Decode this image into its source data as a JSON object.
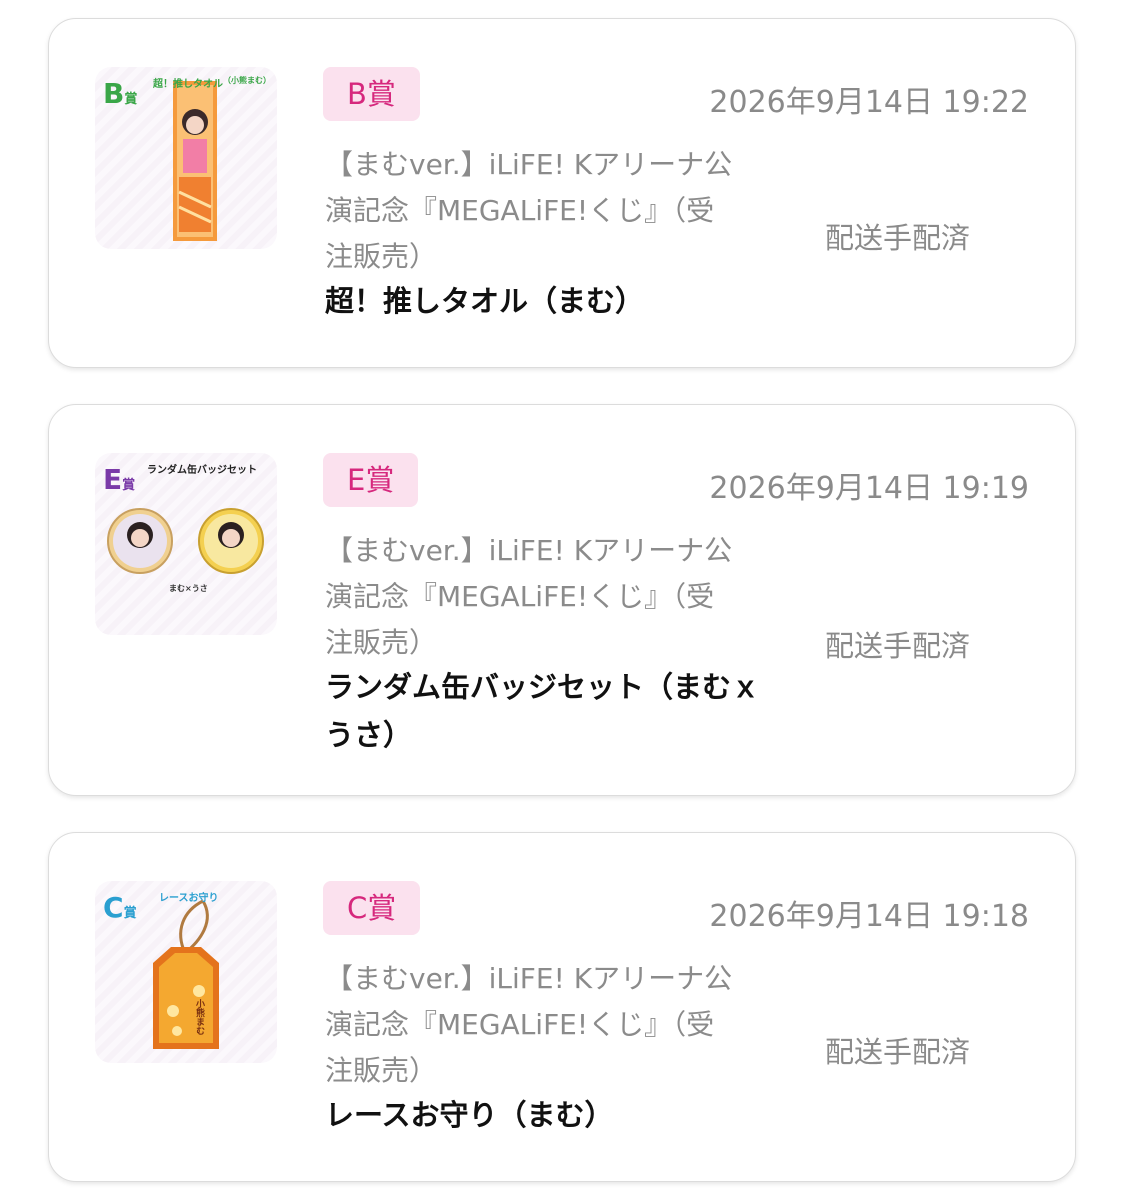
{
  "orders": [
    {
      "prize_badge": "B賞",
      "date": "2026年9月14日 19:22",
      "title": "【まむver.】iLiFE! Kアリーナ公演記念『MEGALiFE!くじ』（受注販売）",
      "item_name": "超！推しタオル（まむ）",
      "status": "配送手配済",
      "thumbnail": {
        "letter": "B",
        "letter_suffix": "賞",
        "label": "超！推しタオル",
        "sublabel": "（小熊まむ）",
        "letter_color": "#3aa648"
      }
    },
    {
      "prize_badge": "E賞",
      "date": "2026年9月14日 19:19",
      "title": "【まむver.】iLiFE! Kアリーナ公演記念『MEGALiFE!くじ』（受注販売）",
      "item_name": "ランダム缶バッジセット（まむｘうさ）",
      "status": "配送手配済",
      "thumbnail": {
        "letter": "E",
        "letter_suffix": "賞",
        "label": "ランダム缶バッジセット",
        "caption": "まむ×うさ",
        "letter_color": "#7a3aa8"
      }
    },
    {
      "prize_badge": "C賞",
      "date": "2026年9月14日 19:18",
      "title": "【まむver.】iLiFE! Kアリーナ公演記念『MEGALiFE!くじ』（受注販売）",
      "item_name": "レースお守り（まむ）",
      "status": "配送手配済",
      "thumbnail": {
        "letter": "C",
        "letter_suffix": "賞",
        "label": "レースお守り",
        "charm_text": "小熊まむ",
        "letter_color": "#2a9fd0"
      }
    }
  ],
  "colors": {
    "badge_bg": "#fbe1ee",
    "badge_text": "#d6287d",
    "muted_text": "#8a8a8a"
  }
}
